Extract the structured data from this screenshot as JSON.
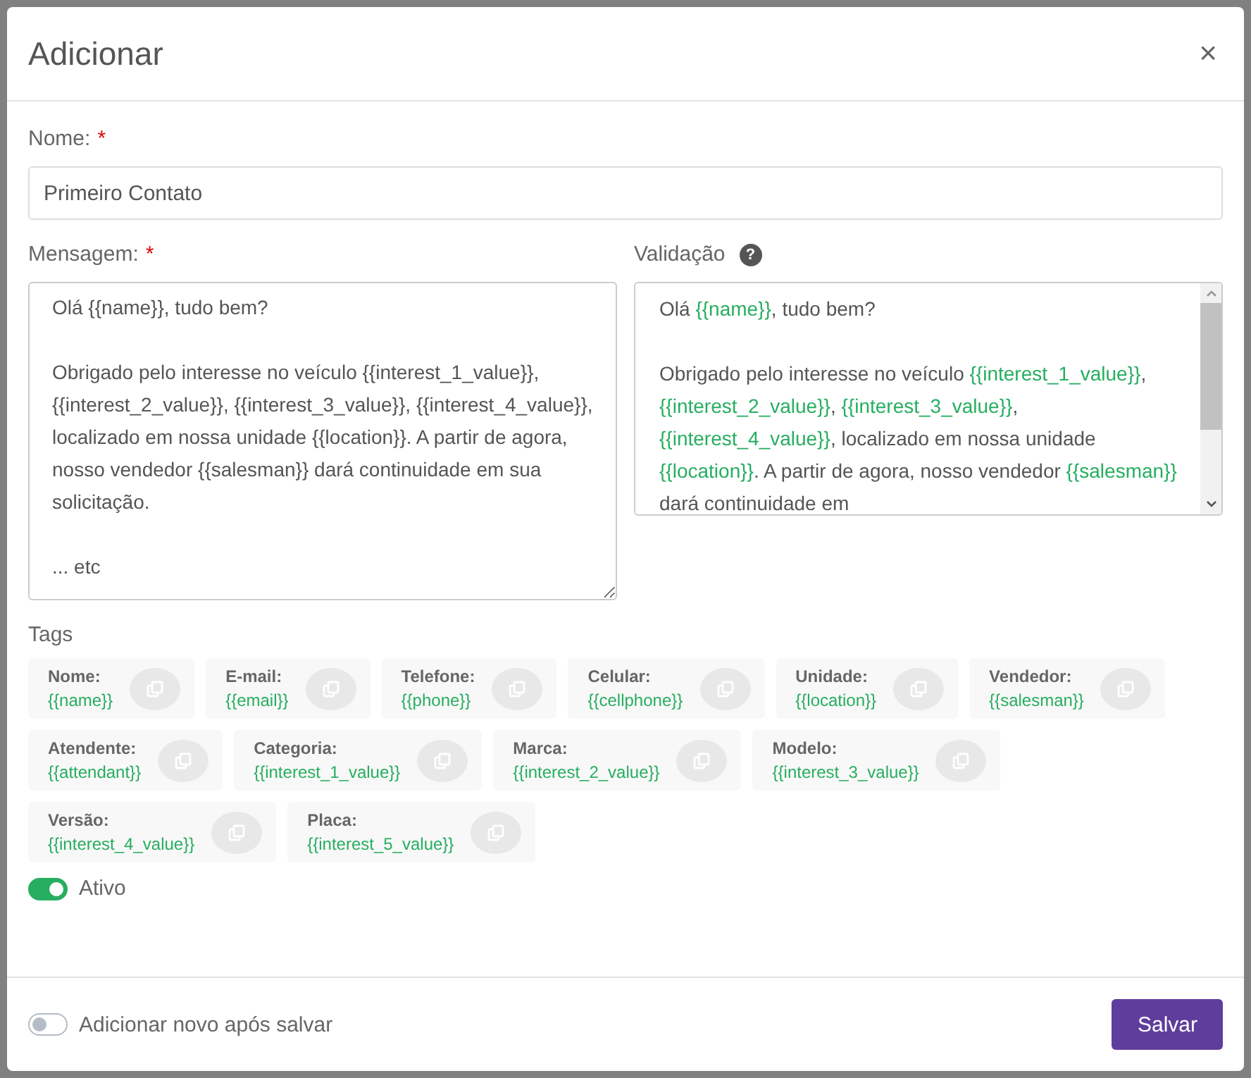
{
  "dialog": {
    "title": "Adicionar",
    "close": "×"
  },
  "name_field": {
    "label": "Nome:",
    "required_mark": "*",
    "value": "Primeiro Contato"
  },
  "message": {
    "label": "Mensagem:",
    "required_mark": "*",
    "value": "Olá {{name}}, tudo bem?\n\nObrigado pelo interesse no veículo {{interest_1_value}}, {{interest_2_value}}, {{interest_3_value}}, {{interest_4_value}}, localizado em nossa unidade {{location}}. A partir de agora, nosso vendedor {{salesman}} dará continuidade em sua solicitação.\n\n... etc"
  },
  "validation": {
    "label": "Validação",
    "help": "?",
    "paragraphs": [
      [
        {
          "kind": "plain",
          "text": "Olá "
        },
        {
          "kind": "tag",
          "text": "{{name}}"
        },
        {
          "kind": "plain",
          "text": ", tudo bem?"
        }
      ],
      [
        {
          "kind": "plain",
          "text": "Obrigado pelo interesse no veículo "
        },
        {
          "kind": "tag",
          "text": "{{interest_1_value}}"
        },
        {
          "kind": "plain",
          "text": ", "
        },
        {
          "kind": "tag",
          "text": "{{interest_2_value}}"
        },
        {
          "kind": "plain",
          "text": ", "
        },
        {
          "kind": "tag",
          "text": "{{interest_3_value}}"
        },
        {
          "kind": "plain",
          "text": ", "
        },
        {
          "kind": "tag",
          "text": "{{interest_4_value}}"
        },
        {
          "kind": "plain",
          "text": ", localizado em nossa unidade "
        },
        {
          "kind": "tag",
          "text": "{{location}}"
        },
        {
          "kind": "plain",
          "text": ". A partir de agora, nosso vendedor "
        },
        {
          "kind": "tag",
          "text": "{{salesman}}"
        },
        {
          "kind": "plain",
          "text": " dará continuidade em"
        }
      ]
    ]
  },
  "tags": {
    "label": "Tags",
    "items": [
      {
        "label": "Nome:",
        "value": "{{name}}"
      },
      {
        "label": "E-mail:",
        "value": "{{email}}"
      },
      {
        "label": "Telefone:",
        "value": "{{phone}}"
      },
      {
        "label": "Celular:",
        "value": "{{cellphone}}"
      },
      {
        "label": "Unidade:",
        "value": "{{location}}"
      },
      {
        "label": "Vendedor:",
        "value": "{{salesman}}"
      },
      {
        "label": "Atendente:",
        "value": "{{attendant}}"
      },
      {
        "label": "Categoria:",
        "value": "{{interest_1_value}}"
      },
      {
        "label": "Marca:",
        "value": "{{interest_2_value}}"
      },
      {
        "label": "Modelo:",
        "value": "{{interest_3_value}}"
      },
      {
        "label": "Versão:",
        "value": "{{interest_4_value}}"
      },
      {
        "label": "Placa:",
        "value": "{{interest_5_value}}"
      }
    ]
  },
  "active": {
    "label": "Ativo",
    "on": true
  },
  "footer": {
    "add_new": {
      "label": "Adicionar novo após salvar",
      "on": false
    },
    "save": "Salvar"
  }
}
